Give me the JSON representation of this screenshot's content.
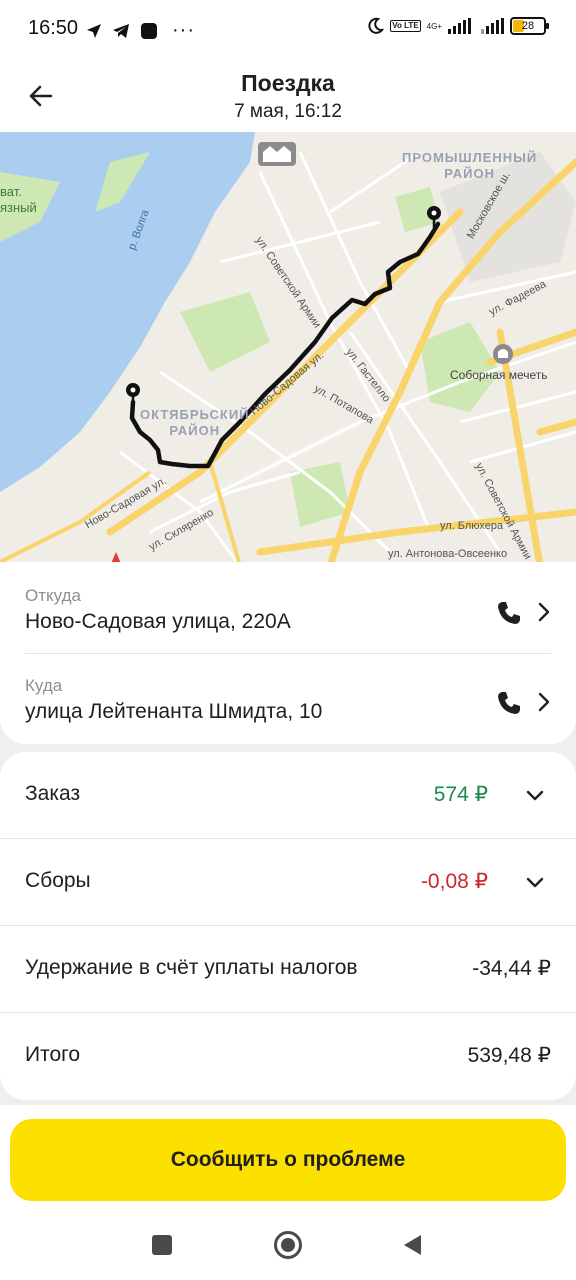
{
  "status_bar": {
    "time": "16:50",
    "dots": "···",
    "net": "4G+",
    "volte": "Vo LTE",
    "battery": "28"
  },
  "header": {
    "title": "Поездка",
    "subtitle": "7 мая, 16:12",
    "back_icon": "arrow-left-icon"
  },
  "map": {
    "districts": [
      "ПРОМЫШЛЕННЫЙ",
      "РАЙОН",
      "ОКТЯБРЬСКИЙ",
      "РАЙОН"
    ],
    "labels": {
      "river": "р. Волга",
      "vat": "ват.",
      "yazny": "язный",
      "sovetskoy_armii": "ул. Советской Армии",
      "moskovskoe": "Московское ш.",
      "fadeeva": "ул. Фадеева",
      "gastello": "ул. Гастелло",
      "sobornaya": "Соборная мечеть",
      "potapova": "ул. Потапова",
      "novo_sadovaya": "Ново-Садовая ул.",
      "sklyarenko": "ул. Скляренко",
      "blyukhera": "ул. Блюхера",
      "sovetskoy_armii_2": "ул. Советской Армии",
      "antonova": "ул. Антонова-Овсеенко",
      "novo_sadovaya_road": "Ново-Садовая ул."
    },
    "colors": {
      "water": "#aacdf0",
      "land": "#f0ede6",
      "park": "#cde8b3",
      "road": "#f8d46b",
      "route": "#111111"
    }
  },
  "addresses": {
    "from": {
      "label": "Откуда",
      "value": "Ново-Садовая улица, 220А"
    },
    "to": {
      "label": "Куда",
      "value": "улица Лейтенанта Шмидта, 10"
    }
  },
  "finance": {
    "order": {
      "label": "Заказ",
      "value": "574 ₽",
      "color": "#1b8a4a"
    },
    "fees": {
      "label": "Сборы",
      "value": "-0,08 ₽",
      "color": "#c8282f"
    },
    "tax": {
      "label": "Удержание в счёт уплаты налогов",
      "value": "-34,44 ₽"
    },
    "total": {
      "label": "Итого",
      "value": "539,48 ₽"
    }
  },
  "report_button": {
    "label": "Сообщить о проблеме",
    "color": "#fce000"
  }
}
